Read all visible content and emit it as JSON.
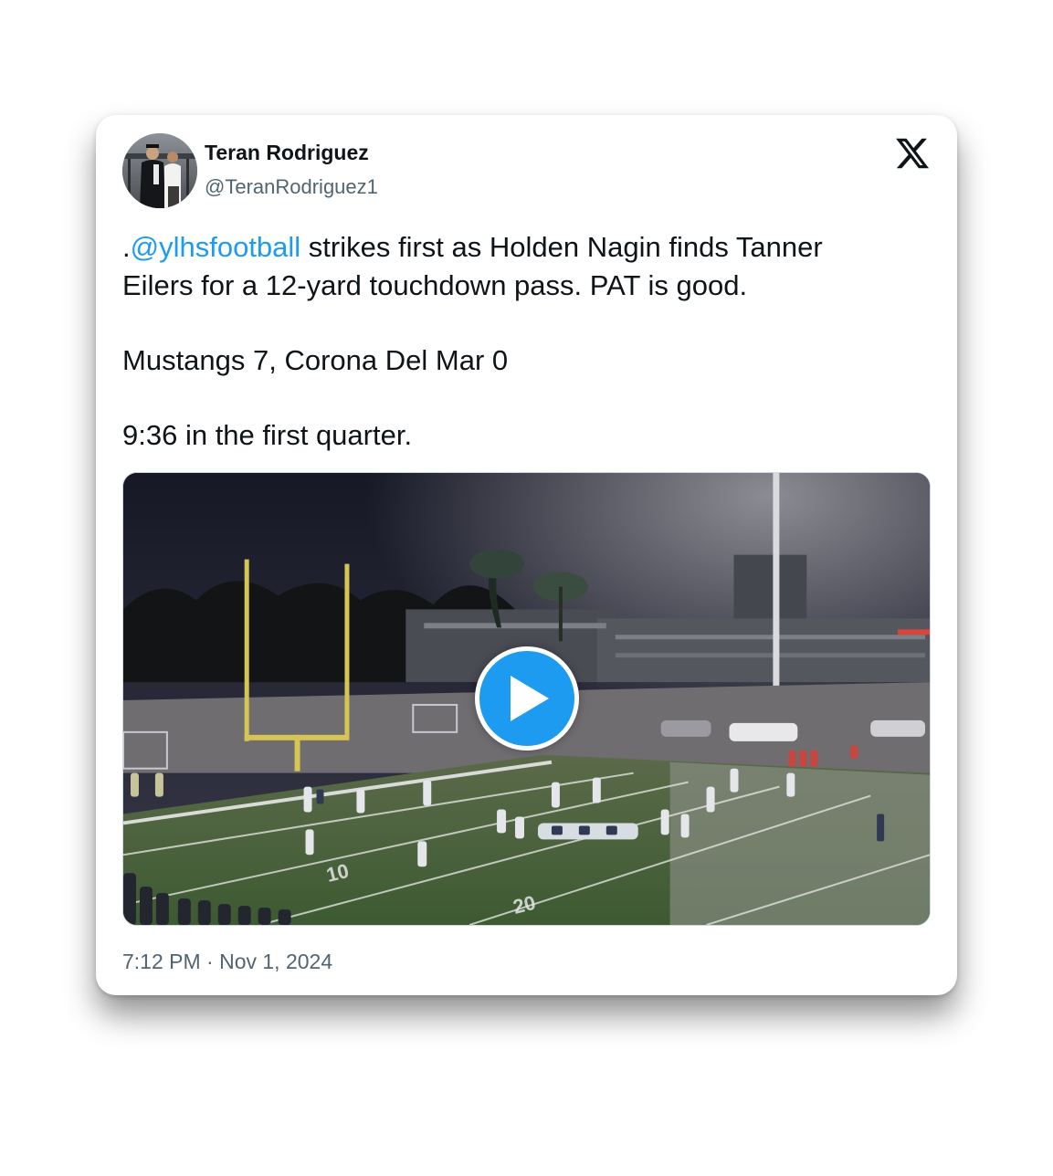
{
  "tweet": {
    "author": {
      "display_name": "Teran Rodriguez",
      "handle": "@TeranRodriguez1",
      "avatar_icon": "profile-photo"
    },
    "platform_icon": "x-logo-icon",
    "text": {
      "line1_prefix": ".",
      "mention": "@ylhsfootball",
      "line1_rest": " strikes first as Holden Nagin finds Tanner",
      "line2": "Eilers for a 12-yard touchdown pass. PAT is good.",
      "score_line": "Mustangs 7, Corona Del Mar 0",
      "time_line": "9:36 in the first quarter."
    },
    "media": {
      "type": "video",
      "play_icon": "play-icon",
      "field_numbers": [
        "10",
        "20"
      ]
    },
    "timestamp": "7:12 PM · Nov 1, 2024"
  },
  "colors": {
    "accent": "#1d9bf0",
    "text_primary": "#0f1419",
    "text_secondary": "#536471"
  }
}
